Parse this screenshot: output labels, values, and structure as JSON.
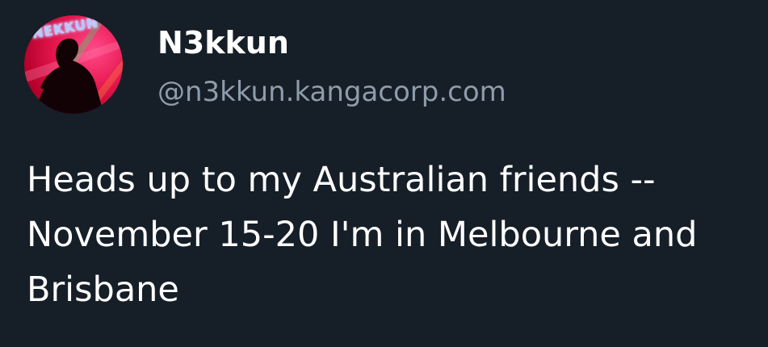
{
  "author": {
    "display_name": "N3kkun",
    "handle": "@n3kkun.kangacorp.com",
    "avatar": {
      "label": "NEKKUN",
      "icon": "profile-avatar-image",
      "colors": {
        "background": "#e8174f",
        "text_glow": "#b9c6ff"
      }
    }
  },
  "post": {
    "text": "Heads up to my Australian friends -- November 15-20 I'm in Melbourne and Brisbane"
  },
  "theme": {
    "background": "#161e27",
    "text": "#ffffff",
    "muted_text": "#8e9cab"
  }
}
